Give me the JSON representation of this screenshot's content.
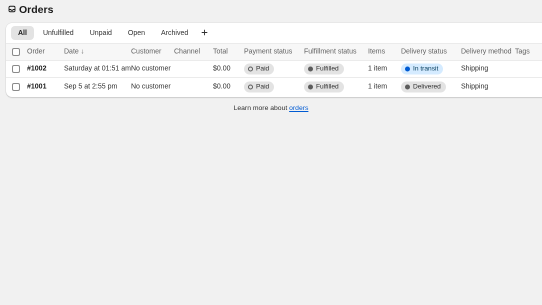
{
  "page": {
    "title": "Orders",
    "icon": "inbox-icon"
  },
  "tabs": [
    {
      "label": "All",
      "active": true
    },
    {
      "label": "Unfulfilled",
      "active": false
    },
    {
      "label": "Unpaid",
      "active": false
    },
    {
      "label": "Open",
      "active": false
    },
    {
      "label": "Archived",
      "active": false
    }
  ],
  "add_tab_icon": "plus-icon",
  "table": {
    "headers": {
      "order": "Order",
      "date": "Date",
      "date_sort": "↓",
      "customer": "Customer",
      "channel": "Channel",
      "total": "Total",
      "payment": "Payment status",
      "fulfillment": "Fulfillment status",
      "items": "Items",
      "delivery": "Delivery status",
      "method": "Delivery method",
      "tags": "Tags"
    },
    "rows": [
      {
        "order": "#1002",
        "date": "Saturday at 01:51 am",
        "customer": "No customer",
        "channel": "",
        "total": "$0.00",
        "payment": "Paid",
        "fulfillment": "Fulfilled",
        "items": "1 item",
        "delivery": "In transit",
        "method": "Shipping",
        "tags": ""
      },
      {
        "order": "#1001",
        "date": "Sep 5 at 2:55 pm",
        "customer": "No customer",
        "channel": "",
        "total": "$0.00",
        "payment": "Paid",
        "fulfillment": "Fulfilled",
        "items": "1 item",
        "delivery": "Delivered",
        "method": "Shipping",
        "tags": ""
      }
    ]
  },
  "footer": {
    "text": "Learn more about ",
    "link": "orders"
  },
  "colors": {
    "link": "#005bd3",
    "in_transit_bg": "#d5ebff",
    "badge_bg": "#e3e3e3"
  }
}
